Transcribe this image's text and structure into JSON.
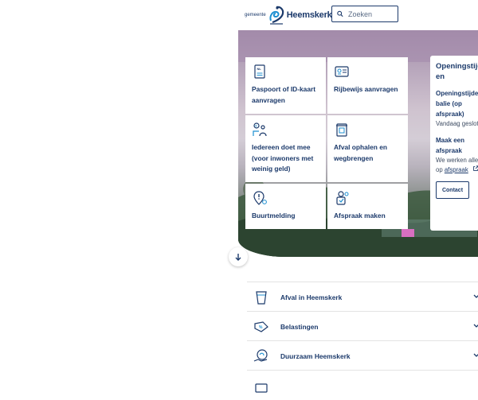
{
  "header": {
    "logo_small": "gemeente",
    "logo_big": "Heemskerk",
    "search_placeholder": "Zoeken"
  },
  "tiles": [
    {
      "label": "Paspoort of ID-kaart aanvragen",
      "icon": "passport-icon"
    },
    {
      "label": "Rijbewijs aanvragen",
      "icon": "drivers-license-icon"
    },
    {
      "label": "Iedereen doet mee (voor inwoners met weinig geld)",
      "icon": "money-people-icon"
    },
    {
      "label": "Afval ophalen en wegbrengen",
      "icon": "waste-bin-icon"
    },
    {
      "label": "Buurtmelding",
      "icon": "location-alert-icon"
    },
    {
      "label": "Afspraak maken",
      "icon": "appointment-icon"
    }
  ],
  "panel": {
    "title": "Openingstijden",
    "heading1": "Openingstijden balie (op afspraak)",
    "text1": "Vandaag gesloten",
    "heading2": "Maak een afspraak",
    "text2_line1": "We werken alleen",
    "text2_prefix": "op ",
    "text2_link": "afspraak",
    "contact_label": "Contact"
  },
  "accordion": [
    {
      "label": "Afval in Heemskerk",
      "icon": "waste-cup-icon"
    },
    {
      "label": "Belastingen",
      "icon": "tax-tag-icon"
    },
    {
      "label": "Duurzaam Heemskerk",
      "icon": "sustainability-icon"
    },
    {
      "label": "",
      "icon": "document-icon"
    }
  ],
  "colors": {
    "primary": "#1c3a6b",
    "accent": "#1c8fd1"
  }
}
